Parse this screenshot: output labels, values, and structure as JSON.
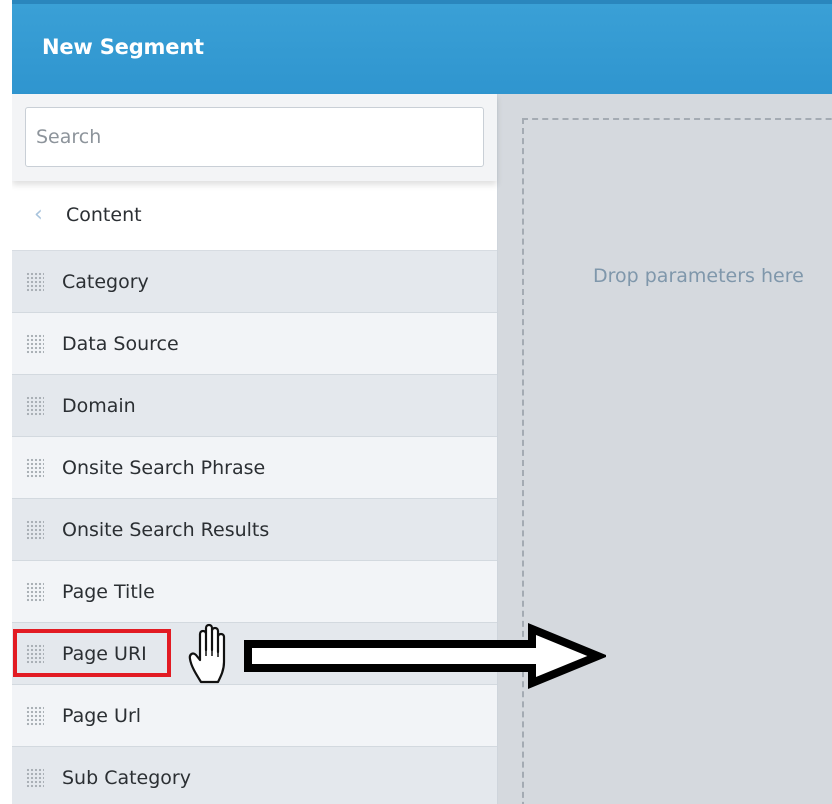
{
  "header": {
    "title": "New Segment"
  },
  "search": {
    "placeholder": "Search",
    "value": ""
  },
  "breadcrumb": {
    "back_label": "Content",
    "back_icon": "chevron-left-icon"
  },
  "parameters": [
    {
      "label": "Category"
    },
    {
      "label": "Data Source"
    },
    {
      "label": "Domain"
    },
    {
      "label": "Onsite Search Phrase"
    },
    {
      "label": "Onsite Search Results"
    },
    {
      "label": "Page Title"
    },
    {
      "label": "Page URI",
      "highlighted": true
    },
    {
      "label": "Page Url"
    },
    {
      "label": "Sub Category"
    }
  ],
  "dropzone": {
    "hint": "Drop parameters here"
  },
  "colors": {
    "header": "#2f95cf",
    "highlight": "#e21b23",
    "hint_text": "#7f97ab"
  }
}
